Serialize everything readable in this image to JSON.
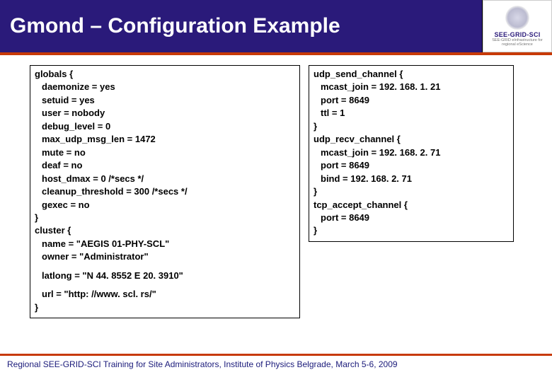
{
  "header": {
    "title": "Gmond – Configuration Example",
    "logo_text": "SEE-GRID-SCI",
    "logo_sub": "SEE-GRID eInfrastructure for regional eScience"
  },
  "config_left": {
    "l0": "globals {",
    "l1": "daemonize = yes",
    "l2": "setuid = yes",
    "l3": "user = nobody",
    "l4": "debug_level = 0",
    "l5": "max_udp_msg_len = 1472",
    "l6": "mute = no",
    "l7": "deaf = no",
    "l8": "host_dmax = 0 /*secs */",
    "l9": "cleanup_threshold = 300 /*secs */",
    "l10": "gexec = no",
    "l11": "}",
    "l12": "cluster {",
    "l13": "name = \"AEGIS 01-PHY-SCL\"",
    "l14": "owner = \"Administrator\"",
    "l15": "latlong = \"N 44. 8552 E 20. 3910\"",
    "l16": "url = \"http: //www. scl. rs/\"",
    "l17": "}"
  },
  "config_right": {
    "r0": "udp_send_channel {",
    "r1": "mcast_join = 192. 168. 1. 21",
    "r2": "port = 8649",
    "r3": "ttl = 1",
    "r4": "}",
    "r5": "udp_recv_channel {",
    "r6": "mcast_join = 192. 168. 2. 71",
    "r7": "port = 8649",
    "r8": "bind = 192. 168. 2. 71",
    "r9": "}",
    "r10": "tcp_accept_channel {",
    "r11": "port = 8649",
    "r12": "}"
  },
  "footer": {
    "text": "Regional SEE-GRID-SCI Training for Site Administrators, Institute of Physics Belgrade, March 5-6, 2009"
  }
}
